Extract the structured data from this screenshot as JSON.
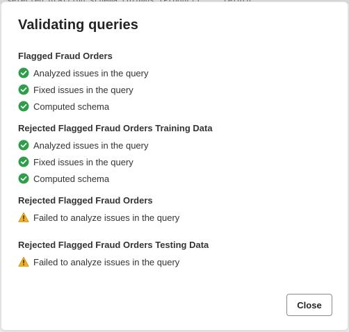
{
  "dialog": {
    "title": "Validating queries",
    "close_label": "Close"
  },
  "groups": [
    {
      "title": "Flagged Fraud Orders",
      "steps": [
        {
          "status": "success",
          "icon": "check-circle-icon",
          "text": "Analyzed issues in the query"
        },
        {
          "status": "success",
          "icon": "check-circle-icon",
          "text": "Fixed issues in the query"
        },
        {
          "status": "success",
          "icon": "check-circle-icon",
          "text": "Computed schema"
        }
      ]
    },
    {
      "title": "Rejected Flagged Fraud Orders Training Data",
      "steps": [
        {
          "status": "success",
          "icon": "check-circle-icon",
          "text": "Analyzed issues in the query"
        },
        {
          "status": "success",
          "icon": "check-circle-icon",
          "text": "Fixed issues in the query"
        },
        {
          "status": "success",
          "icon": "check-circle-icon",
          "text": "Computed schema"
        }
      ]
    },
    {
      "title": "Rejected Flagged Fraud Orders",
      "steps": [
        {
          "status": "warning",
          "icon": "warning-icon",
          "text": "Failed to analyze issues in the query"
        }
      ]
    },
    {
      "title": "Rejected Flagged Fraud Orders Testing Data",
      "steps": [
        {
          "status": "warning",
          "icon": "warning-icon",
          "text": "Failed to analyze issues in the query"
        }
      ]
    }
  ],
  "colors": {
    "success": "#2e9e49",
    "warning": "#f2b01e",
    "text": "#333333"
  }
}
